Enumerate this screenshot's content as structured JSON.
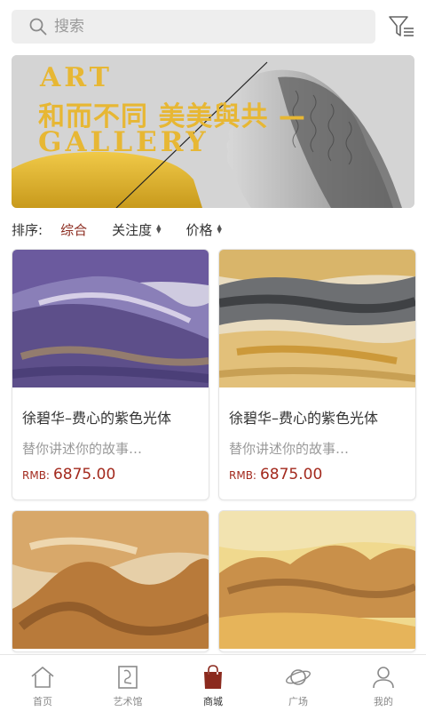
{
  "search": {
    "placeholder": "搜索",
    "icon": "search-icon"
  },
  "filter": {
    "icon": "filter-icon"
  },
  "banner": {
    "line1": "ART",
    "line2": "和而不同 美美與共 —",
    "line3": "GALLERY",
    "accent_color": "#e7b734"
  },
  "sort": {
    "label": "排序:",
    "options": [
      {
        "label": "综合",
        "active": true
      },
      {
        "label": "关注度",
        "active": false
      },
      {
        "label": "价格",
        "active": false
      }
    ],
    "active_color": "#8b2a1e"
  },
  "products": [
    {
      "title": "徐碧华–费心的紫色光体",
      "desc": "替你讲述你的故事…",
      "currency": "RMB:",
      "price": "6875.00"
    },
    {
      "title": "徐碧华–费心的紫色光体",
      "desc": "替你讲述你的故事…",
      "currency": "RMB:",
      "price": "6875.00"
    },
    {
      "title": "",
      "desc": "",
      "currency": "",
      "price": ""
    },
    {
      "title": "",
      "desc": "",
      "currency": "",
      "price": ""
    }
  ],
  "price_color": "#a32a1e",
  "tabs": [
    {
      "label": "首页",
      "icon": "home-icon",
      "active": false
    },
    {
      "label": "艺术馆",
      "icon": "gallery-icon",
      "active": false
    },
    {
      "label": "商城",
      "icon": "shopping-bag-icon",
      "active": true
    },
    {
      "label": "广场",
      "icon": "planet-icon",
      "active": false
    },
    {
      "label": "我的",
      "icon": "user-icon",
      "active": false
    }
  ]
}
